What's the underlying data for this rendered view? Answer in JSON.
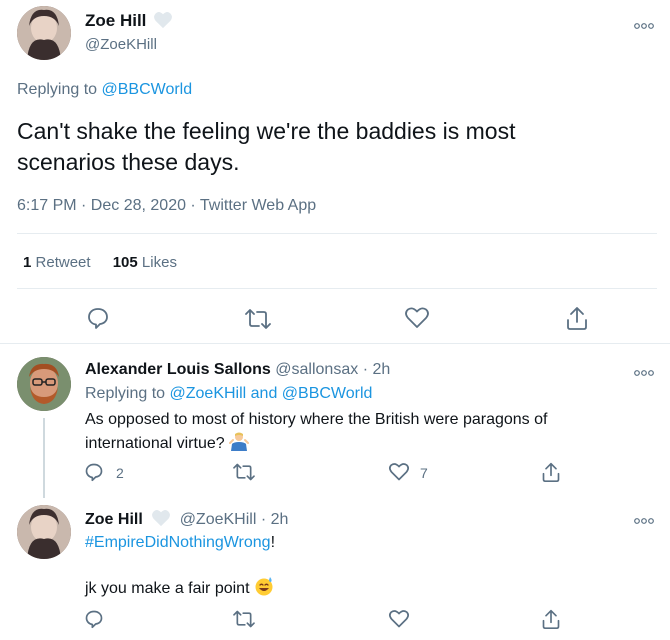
{
  "main_tweet": {
    "author_name": "Zoe Hill",
    "author_handle": "@ZoeKHill",
    "reply_prefix": "Replying to",
    "reply_to": "@BBCWorld",
    "text_line1": "Can't shake the feeling we're the baddies is most",
    "text_line2": "scenarios these days.",
    "timestamp": "6:17 PM · Dec 28, 2020 · Twitter Web App",
    "retweet_count": "1",
    "retweet_label": "Retweet",
    "like_count": "105",
    "like_label": "Likes"
  },
  "reply1": {
    "author_name": "Alexander Louis Sallons",
    "author_handle": "@sallonsax",
    "time": "· 2h",
    "reply_prefix": "Replying to",
    "reply_to": "@ZoeKHill and @BBCWorld",
    "text_line1": "As opposed to most of history where the British were paragons of",
    "text_line2": "international virtue?",
    "reply_count": "2",
    "like_count": "7"
  },
  "reply2": {
    "author_name": "Zoe Hill",
    "author_handle": "@ZoeKHill",
    "time": "· 2h",
    "hashtag": "#EmpireDidNothingWrong",
    "hashtag_suffix": "!",
    "text2": "jk you make a fair point"
  },
  "colors": {
    "link": "#1b95e0",
    "muted": "#5b7083",
    "divider": "#e6ecf0"
  },
  "icons": [
    "heart-badge-icon",
    "more-icon",
    "reply-icon",
    "retweet-icon",
    "like-icon",
    "share-icon",
    "emoji-person-shrugging-icon",
    "emoji-sweat-smile-icon"
  ]
}
